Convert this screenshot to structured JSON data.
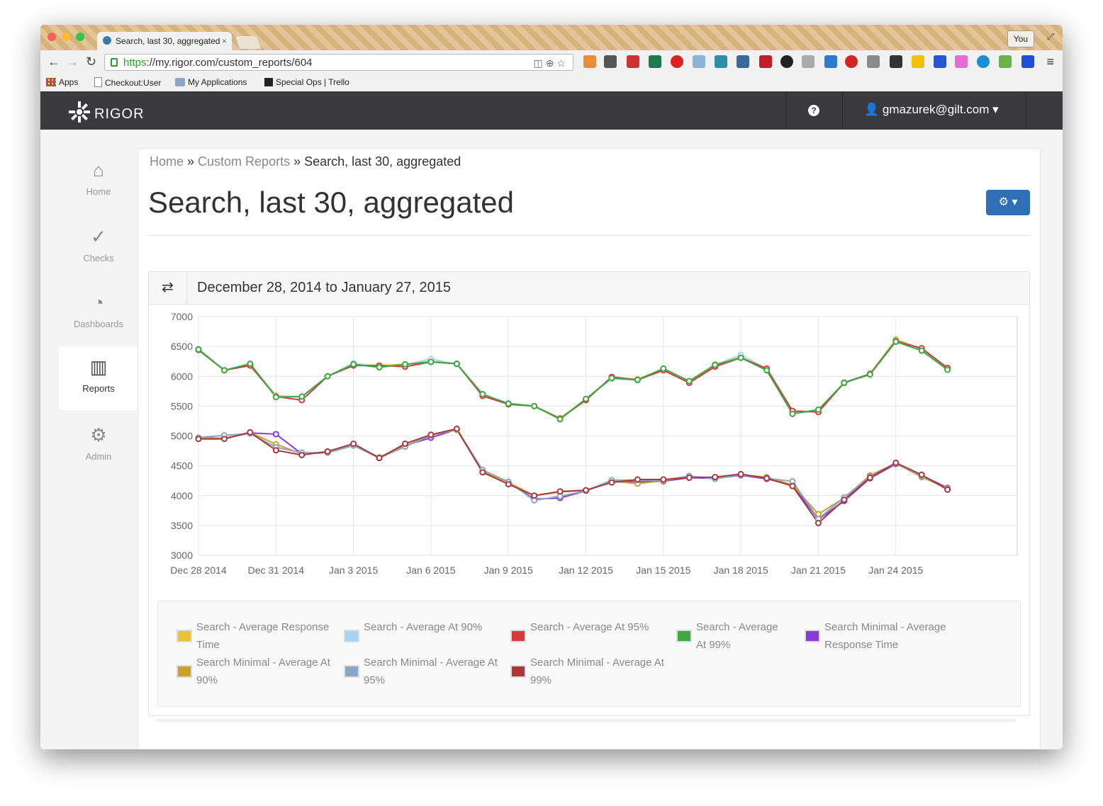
{
  "browser": {
    "tab_title": "Search, last 30, aggregated",
    "tab_close": "×",
    "profile_label": "You",
    "url_scheme": "https",
    "url_rest": "://my.rigor.com/custom_reports/604",
    "bookmarks": [
      "Apps",
      "Checkout:User",
      "My Applications",
      "Special Ops | Trello"
    ]
  },
  "app": {
    "logo_text": "RIGOR",
    "help_label": "?",
    "user_label": "gmazurek@gilt.com ▾"
  },
  "sidebar": {
    "items": [
      {
        "label": "Home",
        "icon": "home-icon",
        "glyph": "⌂"
      },
      {
        "label": "Checks",
        "icon": "check-circle-icon",
        "glyph": "✓"
      },
      {
        "label": "Dashboards",
        "icon": "dashboard-icon",
        "glyph": "◔"
      },
      {
        "label": "Reports",
        "icon": "bar-chart-icon",
        "glyph": "▥"
      },
      {
        "label": "Admin",
        "icon": "gears-icon",
        "glyph": "⚙"
      }
    ]
  },
  "breadcrumb": {
    "home": "Home",
    "sep1": " » ",
    "reports": "Custom Reports",
    "sep2": " » ",
    "current": "Search, last 30, aggregated"
  },
  "page": {
    "title": "Search, last 30, aggregated",
    "gear_label": "⚙ ▾",
    "date_range": "December 28, 2014 to January 27, 2015"
  },
  "colors": {
    "nav_bg": "#3a3a3c",
    "primary_button": "#2f6fb5"
  },
  "chart_data": {
    "type": "line",
    "title": "",
    "xlabel": "",
    "ylabel": "",
    "ylim": [
      3000,
      7000
    ],
    "yticks": [
      3000,
      3500,
      4000,
      4500,
      5000,
      5500,
      6000,
      6500,
      7000
    ],
    "x": [
      "Dec 28",
      "Dec 29",
      "Dec 30",
      "Dec 31",
      "Jan 1",
      "Jan 2",
      "Jan 3",
      "Jan 4",
      "Jan 5",
      "Jan 6",
      "Jan 7",
      "Jan 8",
      "Jan 9",
      "Jan 10",
      "Jan 11",
      "Jan 12",
      "Jan 13",
      "Jan 14",
      "Jan 15",
      "Jan 16",
      "Jan 17",
      "Jan 18",
      "Jan 19",
      "Jan 20",
      "Jan 21",
      "Jan 22",
      "Jan 23",
      "Jan 24",
      "Jan 25",
      "Jan 26"
    ],
    "xticks": [
      {
        "index": 0,
        "label": "Dec 28 2014"
      },
      {
        "index": 3,
        "label": "Dec 31 2014"
      },
      {
        "index": 6,
        "label": "Jan 3 2015"
      },
      {
        "index": 9,
        "label": "Jan 6 2015"
      },
      {
        "index": 12,
        "label": "Jan 9 2015"
      },
      {
        "index": 15,
        "label": "Jan 12 2015"
      },
      {
        "index": 18,
        "label": "Jan 15 2015"
      },
      {
        "index": 21,
        "label": "Jan 18 2015"
      },
      {
        "index": 24,
        "label": "Jan 21 2015"
      },
      {
        "index": 27,
        "label": "Jan 24 2015"
      }
    ],
    "grid": true,
    "legend_position": "bottom",
    "series": [
      {
        "name": "Search - Average Response Time",
        "color": "#e8c23a",
        "values": [
          6450,
          6100,
          6200,
          5680,
          5650,
          6000,
          6200,
          6180,
          6200,
          6250,
          6210,
          5680,
          5540,
          5500,
          5300,
          5620,
          5980,
          5950,
          6120,
          5920,
          6200,
          6320,
          6110,
          5400,
          5420,
          5890,
          6040,
          6620,
          6450,
          6120
        ]
      },
      {
        "name": "Search - Average At 90%",
        "color": "#a6d3f2",
        "values": [
          6460,
          6100,
          6200,
          5670,
          5650,
          6000,
          6220,
          6160,
          6190,
          6290,
          6200,
          5690,
          5550,
          5500,
          5290,
          5620,
          5960,
          5930,
          6110,
          5910,
          6190,
          6360,
          6120,
          5380,
          5420,
          5900,
          6040,
          6600,
          6440,
          6120
        ]
      },
      {
        "name": "Search - Average At 95%",
        "color": "#d43c3c",
        "values": [
          6440,
          6100,
          6180,
          5660,
          5600,
          6000,
          6180,
          6180,
          6160,
          6240,
          6210,
          5670,
          5530,
          5500,
          5290,
          5600,
          5990,
          5940,
          6100,
          5890,
          6160,
          6310,
          6130,
          5420,
          5400,
          5890,
          6040,
          6590,
          6470,
          6140
        ]
      },
      {
        "name": "Search - Average At 99%",
        "color": "#3ea843",
        "values": [
          6450,
          6100,
          6210,
          5650,
          5660,
          6000,
          6200,
          6150,
          6200,
          6240,
          6210,
          5700,
          5540,
          5500,
          5280,
          5620,
          5970,
          5940,
          6130,
          5920,
          6190,
          6310,
          6100,
          5370,
          5440,
          5890,
          6030,
          6580,
          6430,
          6110
        ]
      },
      {
        "name": "Search Minimal - Average Response Time",
        "color": "#8a3bdc",
        "values": [
          4970,
          4960,
          5050,
          5030,
          4700,
          4720,
          4840,
          4640,
          4840,
          4970,
          5110,
          4400,
          4230,
          3940,
          3960,
          4080,
          4240,
          4230,
          4240,
          4300,
          4290,
          4340,
          4280,
          4180,
          3600,
          3910,
          4290,
          4530,
          4340,
          4130
        ]
      },
      {
        "name": "Search Minimal - Average At 90%",
        "color": "#c9a227",
        "values": [
          4960,
          4960,
          5060,
          4860,
          4700,
          4730,
          4840,
          4640,
          4830,
          5020,
          5100,
          4410,
          4220,
          4000,
          4060,
          4090,
          4240,
          4200,
          4250,
          4320,
          4300,
          4350,
          4310,
          4180,
          3690,
          3960,
          4340,
          4540,
          4310,
          4120
        ]
      },
      {
        "name": "Search Minimal - Average At 95%",
        "color": "#8aa6c5",
        "values": [
          4970,
          5010,
          5040,
          4810,
          4720,
          4720,
          4840,
          4630,
          4820,
          5010,
          5110,
          4430,
          4230,
          3920,
          3990,
          4080,
          4260,
          4260,
          4260,
          4330,
          4280,
          4350,
          4290,
          4240,
          3610,
          3970,
          4320,
          4540,
          4330,
          4110
        ]
      },
      {
        "name": "Search Minimal - Average At 99%",
        "color": "#a8383c",
        "values": [
          4950,
          4950,
          5060,
          4760,
          4680,
          4740,
          4870,
          4630,
          4870,
          5020,
          5120,
          4390,
          4190,
          4000,
          4070,
          4090,
          4220,
          4270,
          4270,
          4300,
          4310,
          4360,
          4290,
          4160,
          3540,
          3930,
          4300,
          4550,
          4350,
          4100
        ]
      }
    ]
  }
}
